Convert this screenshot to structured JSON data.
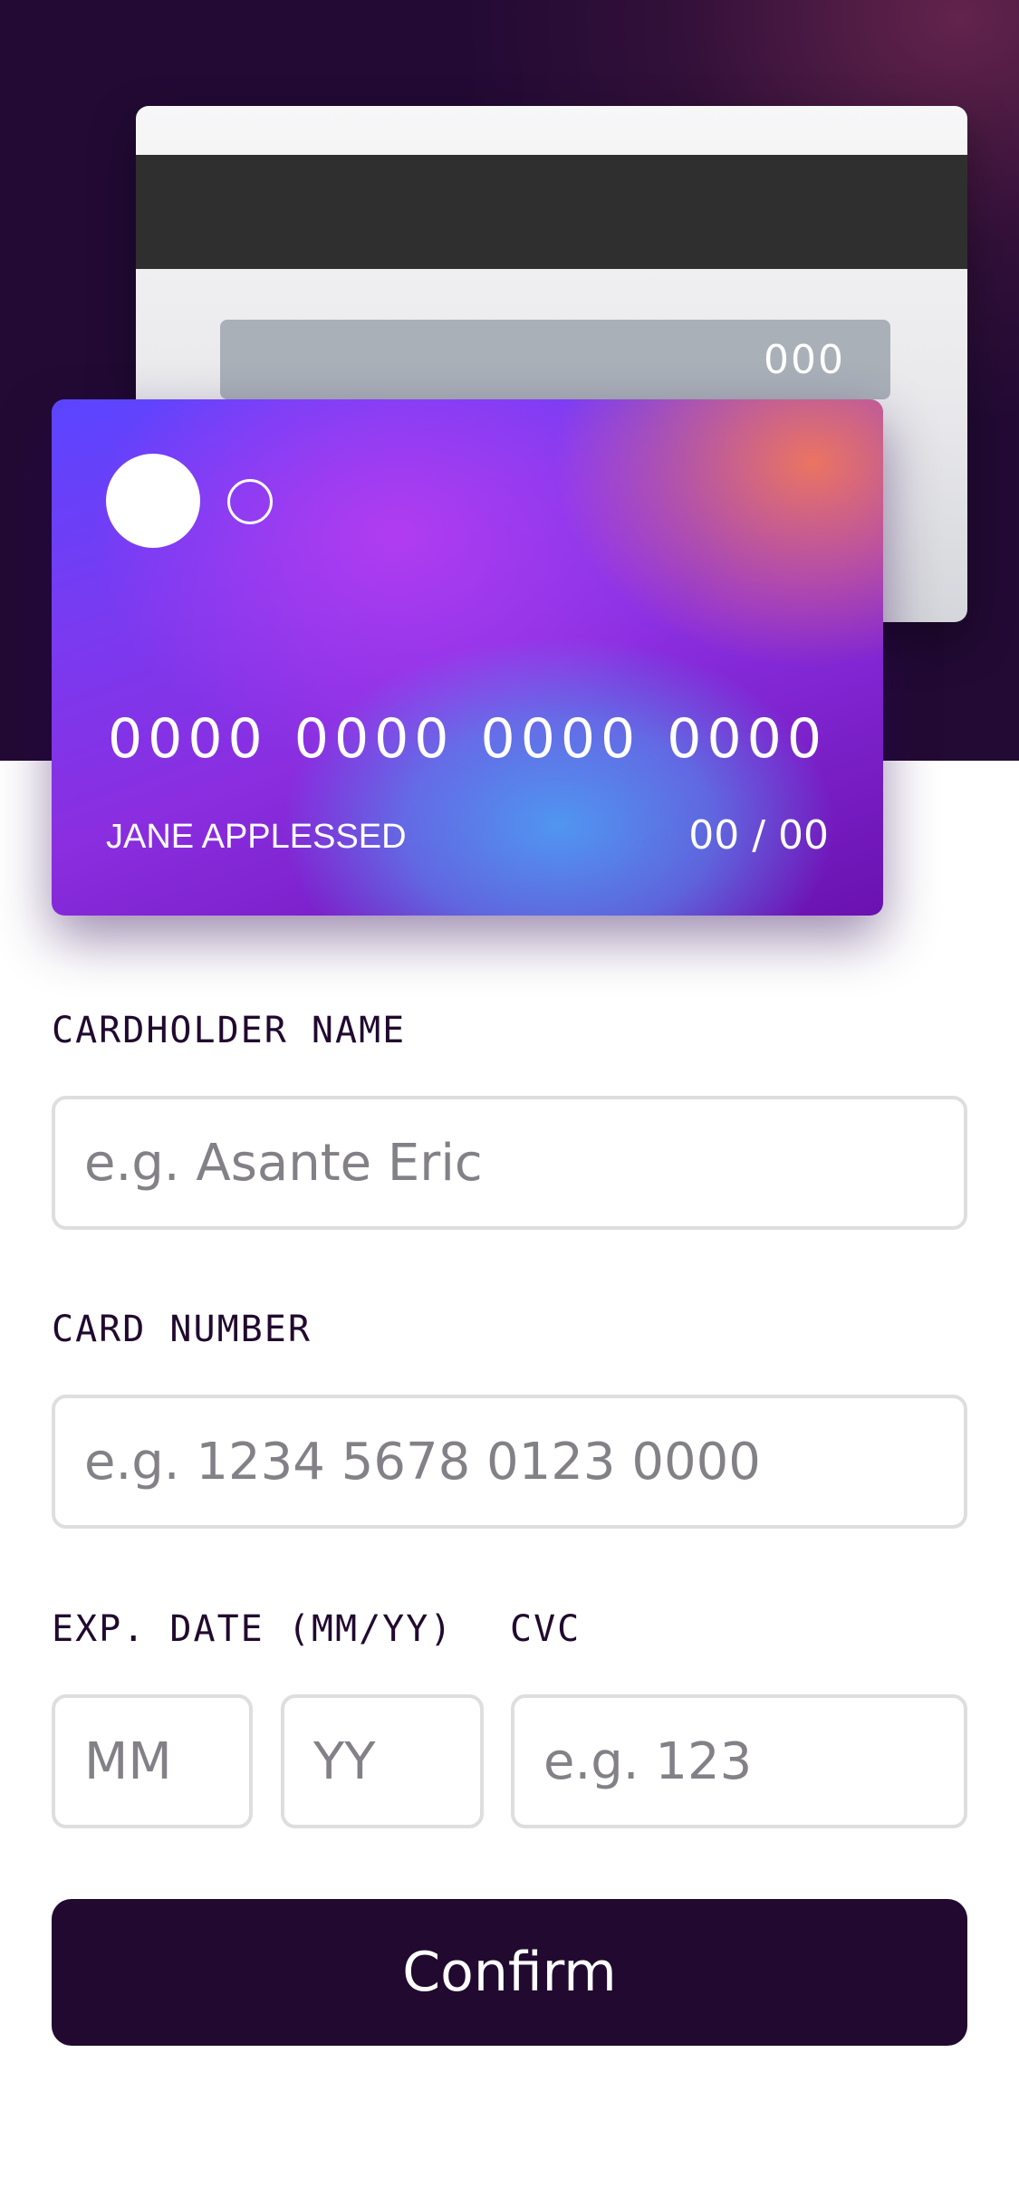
{
  "card_back": {
    "cvc": "000"
  },
  "card_front": {
    "number": "0000 0000 0000 0000",
    "holder": "JANE APPLESSED",
    "expiry": "00 / 00"
  },
  "form": {
    "name_label": "CARDHOLDER NAME",
    "name_placeholder": "e.g. Asante Eric",
    "number_label": "CARD NUMBER",
    "number_placeholder": "e.g. 1234 5678 0123 0000",
    "exp_label": "EXP. DATE (MM/YY)",
    "mm_placeholder": "MM",
    "yy_placeholder": "YY",
    "cvc_label": "CVC",
    "cvc_placeholder": "e.g. 123",
    "confirm_label": "Confirm"
  },
  "colors": {
    "hero_bg": "#220a34",
    "button_bg": "#21092f",
    "input_border": "#dedddf",
    "placeholder": "#838087"
  }
}
